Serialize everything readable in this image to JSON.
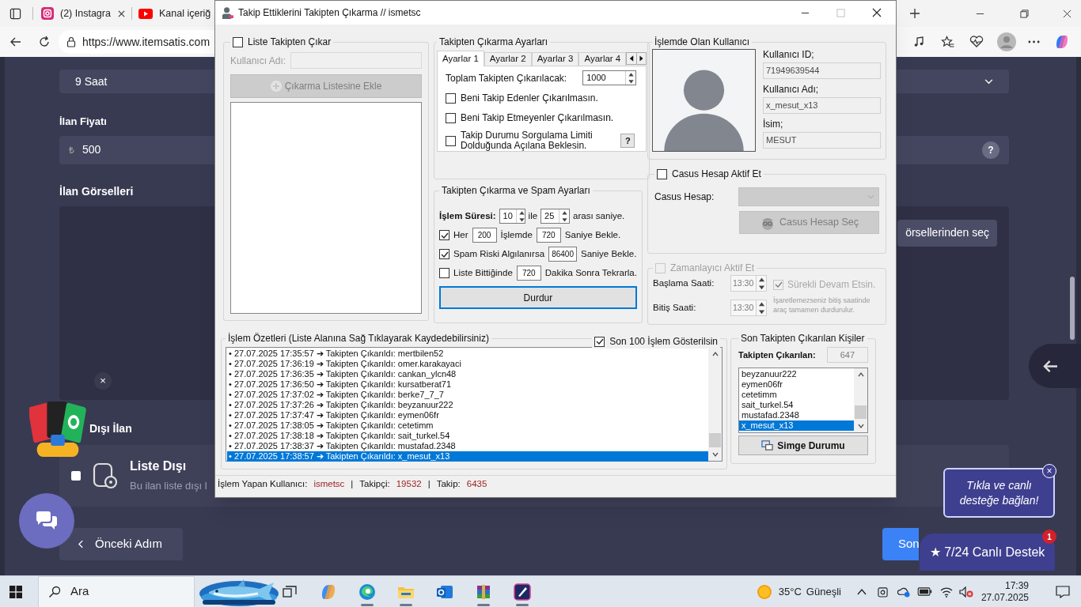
{
  "browser": {
    "tabs": [
      {
        "label": "(2) Instagra",
        "selected": false
      },
      {
        "label": "Kanal içeriğ",
        "selected": false
      }
    ],
    "url": "https://www.itemsatis.com"
  },
  "page": {
    "duration_value": "9 Saat",
    "price_label": "İlan Fiyatı",
    "currency": "₺",
    "price_value": "500",
    "help": "?",
    "images_label": "İlan Görselleri",
    "images_button": "örsellerinden seç",
    "listing_heading": "Dışı İlan",
    "unlisted": {
      "checked": false,
      "title": "Liste Dışı",
      "description": "Bu ilan liste dışı l"
    },
    "prev_button": "Önceki Adım",
    "next_button": "Son",
    "ad_close": "×",
    "tooltip": "Tıkla ve canlı desteğe bağlan!",
    "tooltip_close": "×",
    "support_button": "★ 7/24 Canlı Destek",
    "support_badge": "1"
  },
  "dialog": {
    "title": "Takip Ettiklerini Takipten Çıkarma // ismetsc",
    "list_group": {
      "checked": false,
      "label": "Liste Takipten Çıkar",
      "username_label": "Kullanıcı Adı:",
      "add_button": "Çıkarma Listesine Ekle"
    },
    "settings": {
      "title": "Takipten Çıkarma Ayarları",
      "tabs": [
        {
          "label": "Ayarlar 1",
          "selected": true
        },
        {
          "label": "Ayarlar 2",
          "selected": false
        },
        {
          "label": "Ayarlar 3",
          "selected": false
        },
        {
          "label": "Ayarlar 4",
          "selected": false
        }
      ],
      "total_label": "Toplam Takipten Çıkarılacak:",
      "total_value": "1000",
      "options": [
        {
          "label": "Beni Takip Edenler Çıkarılmasın.",
          "checked": false
        },
        {
          "label": "Beni Takip Etmeyenler Çıkarılmasın.",
          "checked": false
        },
        {
          "label": "Takip Durumu Sorgulama Limiti Dolduğunda Açılana Beklesin.",
          "checked": false
        }
      ],
      "help_button": "?"
    },
    "spam": {
      "title": "Takipten Çıkarma ve Spam Ayarları",
      "duration_label": "İşlem Süresi:",
      "min": "10",
      "between": "ile",
      "max": "25",
      "range_suffix": "arası saniye.",
      "rows": [
        {
          "checked": true,
          "label": "Her",
          "value": "200",
          "middle": "İşlemde",
          "value2": "720",
          "suffix": "Saniye Bekle."
        },
        {
          "checked": true,
          "label": "Spam Riski Algılanırsa",
          "value": "86400",
          "suffix": "Saniye Bekle."
        },
        {
          "checked": false,
          "label": "Liste Bittiğinde",
          "value": "720",
          "suffix": "Dakika Sonra Tekrarla."
        }
      ],
      "stop_button": "Durdur"
    },
    "current_user": {
      "title": "İşlemde Olan Kullanıcı",
      "fields": [
        {
          "label": "Kullanıcı ID;",
          "value": "71949639544"
        },
        {
          "label": "Kullanıcı Adı;",
          "value": "x_mesut_x13"
        },
        {
          "label": "İsim;",
          "value": "MESUT"
        }
      ]
    },
    "spy": {
      "checked": false,
      "label": "Casus Hesap Aktif Et",
      "account_label": "Casus Hesap:",
      "select_button": "Casus Hesap Seç"
    },
    "scheduler": {
      "checked": false,
      "label": "Zamanlayıcı Aktif Et",
      "start_label": "Başlama Saati:",
      "start_value": "13:30",
      "end_label": "Bitiş Saati:",
      "end_value": "13:30",
      "continuous": {
        "checked": true,
        "label": "Sürekli Devam Etsin."
      },
      "note": "İşaretlemezseniz bitiş saatinde araç tamamen durdurulur."
    },
    "log": {
      "title": "İşlem Özetleri (Liste Alanına Sağ Tıklayarak Kaydedebilirsiniz)",
      "show_last": {
        "checked": true,
        "label": "Son 100 İşlem Gösterilsin"
      },
      "entries": [
        {
          "text": "• 27.07.2025 17:35:57 ➔ Takipten Çıkarıldı: mertbilen52",
          "selected": false
        },
        {
          "text": "• 27.07.2025 17:36:19 ➔ Takipten Çıkarıldı: omer.karakayaci",
          "selected": false
        },
        {
          "text": "• 27.07.2025 17:36:35 ➔ Takipten Çıkarıldı: cankan_ylcn48",
          "selected": false
        },
        {
          "text": "• 27.07.2025 17:36:50 ➔ Takipten Çıkarıldı: kursatberat71",
          "selected": false
        },
        {
          "text": "• 27.07.2025 17:37:02 ➔ Takipten Çıkarıldı: berke7_7_7",
          "selected": false
        },
        {
          "text": "• 27.07.2025 17:37:26 ➔ Takipten Çıkarıldı: beyzanuur222",
          "selected": false
        },
        {
          "text": "• 27.07.2025 17:37:47 ➔ Takipten Çıkarıldı: eymen06fr",
          "selected": false
        },
        {
          "text": "• 27.07.2025 17:38:05 ➔ Takipten Çıkarıldı: cetetimm",
          "selected": false
        },
        {
          "text": "• 27.07.2025 17:38:18 ➔ Takipten Çıkarıldı: sait_turkel.54",
          "selected": false
        },
        {
          "text": "• 27.07.2025 17:38:37 ➔ Takipten Çıkarıldı: mustafad.2348",
          "selected": false
        },
        {
          "text": "• 27.07.2025 17:38:57 ➔ Takipten Çıkarıldı: x_mesut_x13",
          "selected": true
        }
      ]
    },
    "recent": {
      "title": "Son Takipten Çıkarılan Kişiler",
      "count_label": "Takipten Çıkarılan:",
      "count": "647",
      "users": [
        {
          "name": "beyzanuur222",
          "selected": false
        },
        {
          "name": "eymen06fr",
          "selected": false
        },
        {
          "name": "cetetimm",
          "selected": false
        },
        {
          "name": "sait_turkel.54",
          "selected": false
        },
        {
          "name": "mustafad.2348",
          "selected": false
        },
        {
          "name": "x_mesut_x13",
          "selected": true
        }
      ],
      "minimize_button": "Simge Durumu"
    },
    "status": {
      "user_label": "İşlem Yapan Kullanıcı:",
      "user": "ismetsc",
      "separators": [
        "|",
        "|"
      ],
      "followers_label": "Takipçi:",
      "followers": "19532",
      "following_label": "Takip:",
      "following": "6435"
    }
  },
  "taskbar": {
    "search": "Ara",
    "temperature": "35°C",
    "condition": "Güneşli",
    "time": "17:39",
    "date": "27.07.2025"
  }
}
